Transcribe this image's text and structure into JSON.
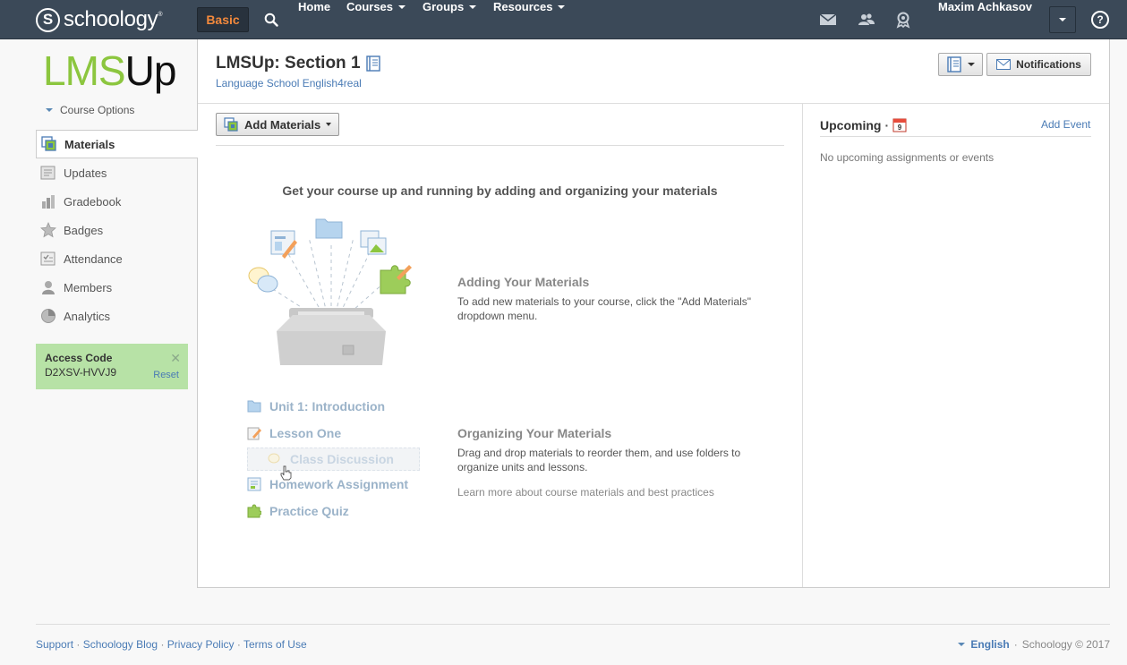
{
  "topbar": {
    "logo_text": "schoology",
    "logo_letter": "S",
    "logo_reg": "®",
    "basic_label": "Basic",
    "nav": [
      "Home",
      "Courses",
      "Groups",
      "Resources"
    ],
    "user_name": "Maxim Achkasov",
    "help_label": "?"
  },
  "sidebar": {
    "course_logo_part1": "LMS",
    "course_logo_part2": "Up",
    "course_options": "Course Options",
    "items": [
      {
        "label": "Materials",
        "icon": "materials-icon"
      },
      {
        "label": "Updates",
        "icon": "updates-icon"
      },
      {
        "label": "Gradebook",
        "icon": "gradebook-icon"
      },
      {
        "label": "Badges",
        "icon": "badge-icon"
      },
      {
        "label": "Attendance",
        "icon": "attendance-icon"
      },
      {
        "label": "Members",
        "icon": "members-icon"
      },
      {
        "label": "Analytics",
        "icon": "analytics-icon"
      }
    ],
    "access_code": {
      "title": "Access Code",
      "code": "D2XSV-HVVJ9",
      "reset": "Reset",
      "close": "✕"
    }
  },
  "main": {
    "title": "LMSUp: Section 1",
    "school": "Language School English4real",
    "notifications_label": "Notifications",
    "add_materials_label": "Add Materials",
    "empty_heading": "Get your course up and running by adding and organizing your materials",
    "adding_title": "Adding Your Materials",
    "adding_text": "To add new materials to your course, click the \"Add Materials\" dropdown menu.",
    "organizing_title": "Organizing Your Materials",
    "organizing_text": "Drag and drop materials to reorder them, and use folders to organize units and lessons.",
    "learn_more": "Learn more about course materials and best practices",
    "demo_items": {
      "unit": "Unit 1: Introduction",
      "lesson": "Lesson One",
      "discussion": "Class Discussion",
      "homework": "Homework Assignment",
      "quiz": "Practice Quiz"
    }
  },
  "upcoming": {
    "title": "Upcoming",
    "separator": "·",
    "calendar_day": "9",
    "add_event": "Add Event",
    "empty": "No upcoming assignments or events"
  },
  "footer": {
    "links": [
      "Support",
      "Schoology Blog",
      "Privacy Policy",
      "Terms of Use"
    ],
    "separator": "·",
    "language": "English",
    "copyright": "Schoology © 2017"
  },
  "colors": {
    "topbar": "#3b4958",
    "basic_orange": "#f3893c",
    "link_blue": "#4a7bb5",
    "logo_green": "#8cc63f",
    "access_green": "#b7e2a6"
  }
}
